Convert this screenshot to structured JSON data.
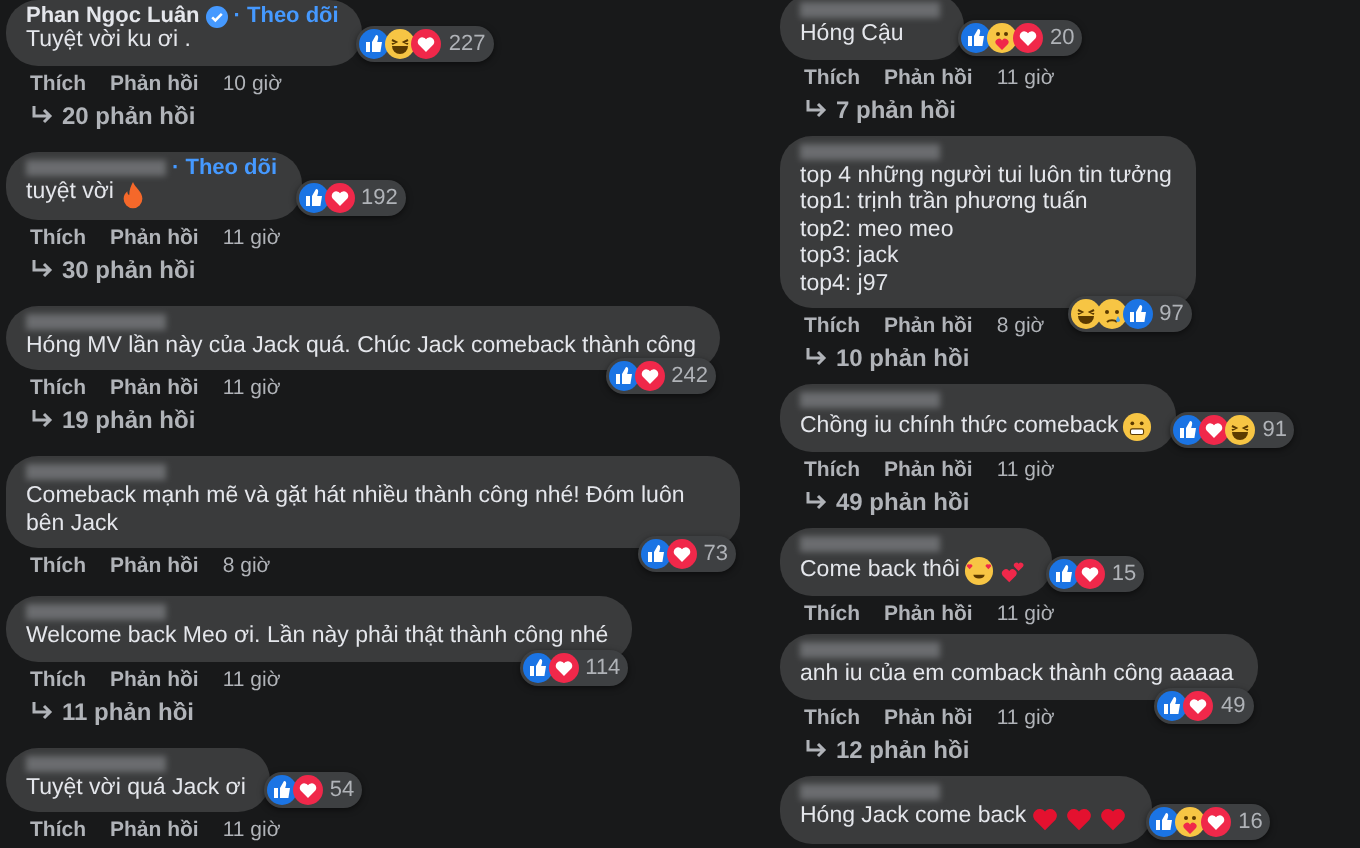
{
  "columns": [
    {
      "comments": [
        {
          "author": {
            "name": "Phan Ngọc Luân",
            "verified": true,
            "follow": "· Theo dõi",
            "blurred": false
          },
          "lines": [
            "Tuyệt vời ku ơi ."
          ],
          "reactions": [
            {
              "kind": "like"
            },
            {
              "kind": "haha"
            },
            {
              "kind": "love"
            }
          ],
          "count": "227",
          "actions": [
            "Thích",
            "Phản hồi"
          ],
          "time": "10 giờ",
          "replies": "20 phản hồi"
        },
        {
          "author": {
            "follow": "· Theo dõi",
            "blurred": true
          },
          "lines": [
            "tuyệt vời"
          ],
          "emojis": [
            {
              "kind": "fire"
            }
          ],
          "reactions": [
            {
              "kind": "like"
            },
            {
              "kind": "love"
            }
          ],
          "count": "192",
          "actions": [
            "Thích",
            "Phản hồi"
          ],
          "time": "11 giờ",
          "replies": "30 phản hồi"
        },
        {
          "author": {
            "blurred": true
          },
          "lines": [
            "Hóng MV lần này của Jack quá. Chúc Jack comeback thành công"
          ],
          "reactions": [
            {
              "kind": "like"
            },
            {
              "kind": "love"
            }
          ],
          "count": "242",
          "actions": [
            "Thích",
            "Phản hồi"
          ],
          "time": "11 giờ",
          "replies": "19 phản hồi"
        },
        {
          "author": {
            "blurred": true
          },
          "lines": [
            "Comeback mạnh mẽ và gặt hát nhiều thành công nhé! Đóm luôn bên Jack"
          ],
          "reactions": [
            {
              "kind": "like"
            },
            {
              "kind": "love"
            }
          ],
          "count": "73",
          "actions": [
            "Thích",
            "Phản hồi"
          ],
          "time": "8 giờ"
        },
        {
          "author": {
            "blurred": true
          },
          "lines": [
            "Welcome back Meo ơi. Lần này phải thật thành công nhé"
          ],
          "reactions": [
            {
              "kind": "like"
            },
            {
              "kind": "love"
            }
          ],
          "count": "114",
          "actions": [
            "Thích",
            "Phản hồi"
          ],
          "time": "11 giờ",
          "replies": "11 phản hồi"
        },
        {
          "author": {
            "blurred": true
          },
          "lines": [
            "Tuyệt vời quá Jack ơi"
          ],
          "reactions": [
            {
              "kind": "like"
            },
            {
              "kind": "love"
            }
          ],
          "count": "54",
          "actions": [
            "Thích",
            "Phản hồi"
          ],
          "time": "11 giờ"
        }
      ]
    },
    {
      "comments": [
        {
          "author": {
            "blurred": true
          },
          "lines": [
            "Hóng Cậu"
          ],
          "reactions": [
            {
              "kind": "like"
            },
            {
              "kind": "care"
            },
            {
              "kind": "love"
            }
          ],
          "count": "20",
          "actions": [
            "Thích",
            "Phản hồi"
          ],
          "time": "11 giờ",
          "replies": "7 phản hồi"
        },
        {
          "author": {
            "blurred": true
          },
          "lines": [
            "top 4 những người tui luôn tin tưởng",
            "top1: trịnh trần phương tuấn",
            "top2: meo meo",
            "top3: jack",
            "top4: j97"
          ],
          "reactions": [
            {
              "kind": "haha"
            },
            {
              "kind": "sad"
            },
            {
              "kind": "like"
            }
          ],
          "count": "97",
          "actions": [
            "Thích",
            "Phản hồi"
          ],
          "time": "8 giờ",
          "replies": "10 phản hồi"
        },
        {
          "author": {
            "blurred": true
          },
          "lines": [
            "Chồng iu chính thức comeback"
          ],
          "emojis": [
            {
              "kind": "grimace"
            }
          ],
          "reactions": [
            {
              "kind": "like"
            },
            {
              "kind": "love"
            },
            {
              "kind": "haha"
            }
          ],
          "count": "91",
          "actions": [
            "Thích",
            "Phản hồi"
          ],
          "time": "11 giờ",
          "replies": "49 phản hồi"
        },
        {
          "author": {
            "blurred": true
          },
          "lines": [
            "Come back thôi"
          ],
          "emojis": [
            {
              "kind": "hearts-face"
            },
            {
              "kind": "two-hearts"
            }
          ],
          "reactions": [
            {
              "kind": "like"
            },
            {
              "kind": "love"
            }
          ],
          "count": "15",
          "actions": [
            "Thích",
            "Phản hồi"
          ],
          "time": "11 giờ"
        },
        {
          "author": {
            "blurred": true
          },
          "lines": [
            "anh iu của em comback thành công aaaaa"
          ],
          "reactions": [
            {
              "kind": "like"
            },
            {
              "kind": "love"
            }
          ],
          "count": "49",
          "actions": [
            "Thích",
            "Phản hồi"
          ],
          "time": "11 giờ",
          "replies": "12 phản hồi"
        },
        {
          "author": {
            "blurred": true
          },
          "lines": [
            "Hóng Jack come back"
          ],
          "emojis": [
            {
              "kind": "heart"
            },
            {
              "kind": "heart"
            },
            {
              "kind": "heart"
            }
          ],
          "reactions": [
            {
              "kind": "like"
            },
            {
              "kind": "care"
            },
            {
              "kind": "love"
            }
          ],
          "count": "16"
        }
      ]
    }
  ]
}
